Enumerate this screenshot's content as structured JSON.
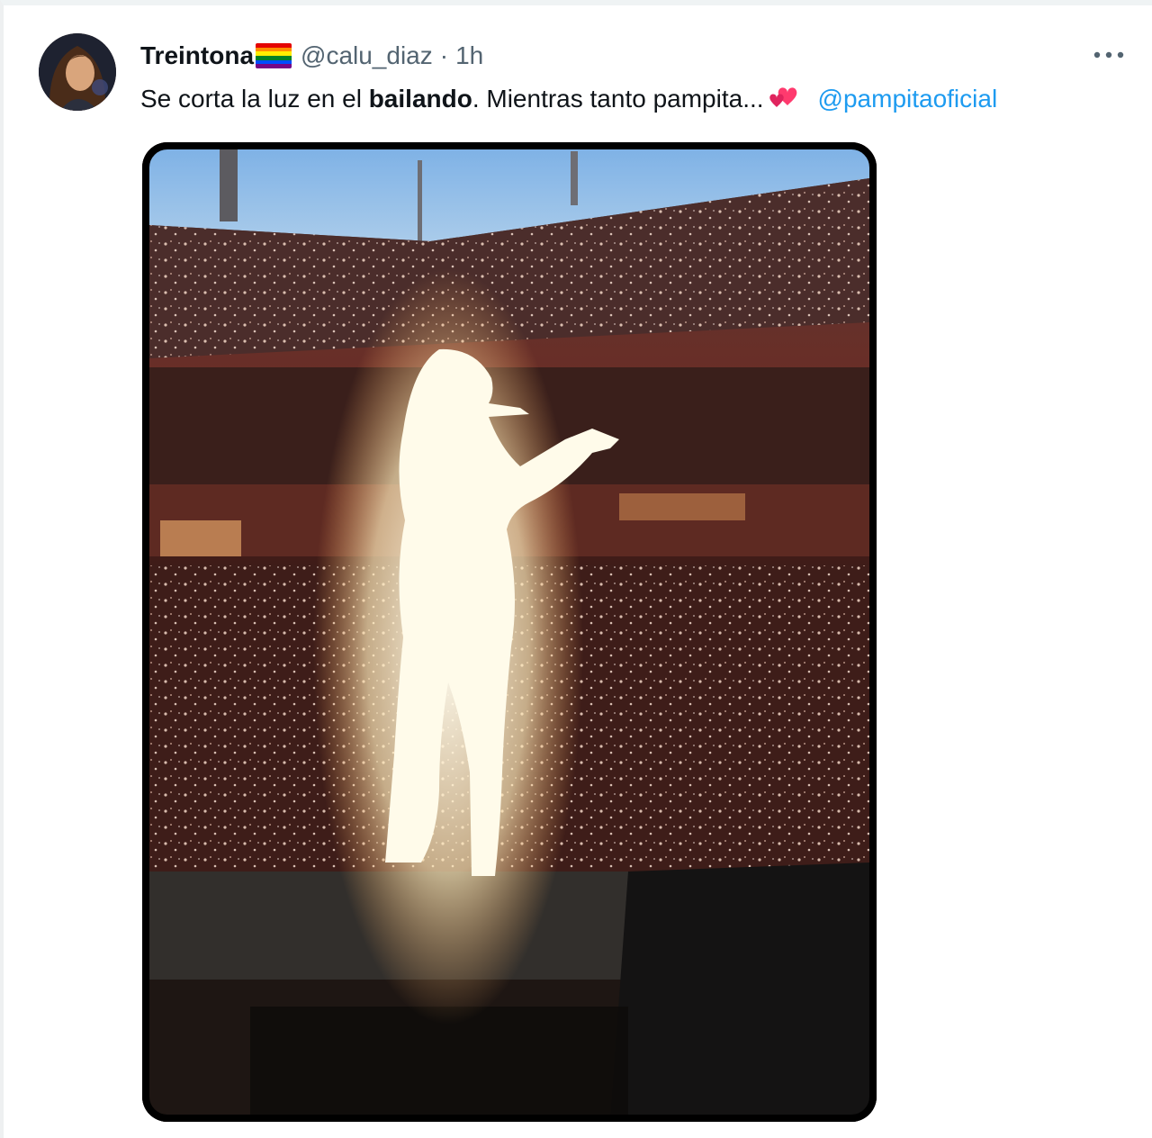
{
  "tweet": {
    "display_name": "Treintona",
    "handle": "@calu_diaz",
    "separator": "·",
    "time": "1h",
    "text_before": "Se corta la luz en el ",
    "text_bold": "bailando",
    "text_after": ". Mientras tanto pampita...",
    "mention": "@pampitaoficial",
    "more_icon": "more-horizontal-icon",
    "flag_icon": "rainbow-flag-icon",
    "emoji_icon": "two-hearts-icon"
  },
  "colors": {
    "text_primary": "#0f1419",
    "text_secondary": "#536471",
    "link": "#1d9bf0",
    "rainbow": [
      "#e40303",
      "#ff8c00",
      "#ffed00",
      "#008026",
      "#004dff",
      "#750787"
    ]
  },
  "media": {
    "type": "video",
    "description_icon": "concert-video-thumbnail"
  }
}
